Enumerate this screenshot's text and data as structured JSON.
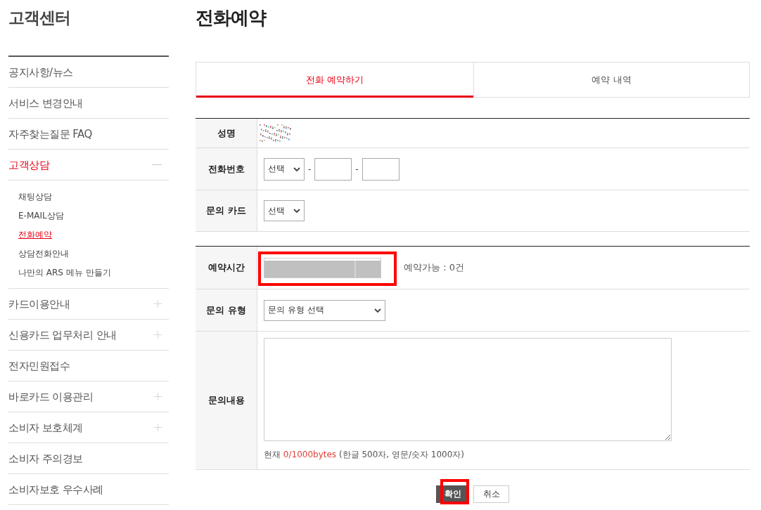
{
  "sidebar": {
    "title": "고객센터",
    "items": [
      {
        "label": "공지사항/뉴스",
        "kind": "link",
        "selected": false
      },
      {
        "label": "서비스 변경안내",
        "kind": "link",
        "selected": false
      },
      {
        "label": "자주찾는질문 FAQ",
        "kind": "link",
        "selected": false
      },
      {
        "label": "고객상담",
        "kind": "group",
        "selected": true,
        "expanded": true,
        "children": [
          {
            "label": "채팅상담",
            "selected": false
          },
          {
            "label": "E-MAIL상담",
            "selected": false
          },
          {
            "label": "전화예약",
            "selected": true
          },
          {
            "label": "상담전화안내",
            "selected": false
          },
          {
            "label": "나만의 ARS 메뉴 만들기",
            "selected": false
          }
        ]
      },
      {
        "label": "카드이용안내",
        "kind": "group",
        "selected": false,
        "expanded": false
      },
      {
        "label": "신용카드 업무처리 안내",
        "kind": "group",
        "selected": false,
        "expanded": false
      },
      {
        "label": "전자민원접수",
        "kind": "link",
        "selected": false
      },
      {
        "label": "바로카드 이용관리",
        "kind": "group",
        "selected": false,
        "expanded": false
      },
      {
        "label": "소비자 보호체계",
        "kind": "group",
        "selected": false,
        "expanded": false
      },
      {
        "label": "소비자 주의경보",
        "kind": "link",
        "selected": false
      },
      {
        "label": "소비자보호 우수사례",
        "kind": "link",
        "selected": false
      }
    ]
  },
  "page_title": "전화예약",
  "tabs": [
    {
      "label": "전화 예약하기",
      "selected": true
    },
    {
      "label": "예약 내역",
      "selected": false
    }
  ],
  "form": {
    "sections": [
      {
        "rows": [
          {
            "label": "성명",
            "kind": "masked"
          },
          {
            "label": "전화번호",
            "kind": "phone",
            "value": "선택",
            "separators": [
              "-",
              "-"
            ]
          },
          {
            "label": "문의 카드",
            "kind": "select",
            "value": "선택"
          }
        ]
      },
      {
        "rows": [
          {
            "label": "예약시간",
            "kind": "time",
            "disabled": true,
            "highlighted": true,
            "availability": "예약가능 : 0건"
          },
          {
            "label": "문의 유형",
            "kind": "wide_select",
            "value": "문의 유형 선택"
          },
          {
            "label": "문의내용",
            "kind": "textarea",
            "counter": {
              "prefix": "현재",
              "value": "0/1000bytes",
              "note": "(한글 500자, 영문/숫자 1000자)"
            }
          }
        ]
      }
    ]
  },
  "buttons": [
    {
      "label": "확인",
      "kind": "primary",
      "highlighted": true
    },
    {
      "label": "취소",
      "kind": "secondary",
      "highlighted": false
    }
  ]
}
